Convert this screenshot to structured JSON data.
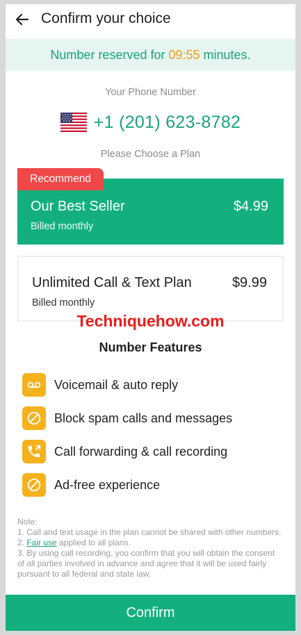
{
  "header": {
    "title": "Confirm your choice"
  },
  "timer": {
    "prefix": "Number reserved for ",
    "time": "09:55",
    "suffix": " minutes."
  },
  "phone": {
    "label": "Your Phone Number",
    "number": "+1 (201) 623-8782",
    "flag_icon": "us-flag-icon"
  },
  "plans": {
    "label": "Please Choose a Plan",
    "badge": "Recommend",
    "items": [
      {
        "name": "Our Best Seller",
        "price": "$4.99",
        "billing": "Billed monthly",
        "selected": true
      },
      {
        "name": "Unlimited Call & Text Plan",
        "price": "$9.99",
        "billing": "Billed monthly",
        "selected": false
      }
    ]
  },
  "watermark": "Techniquehow.com",
  "features": {
    "title": "Number Features",
    "items": [
      {
        "icon": "voicemail-icon",
        "label": "Voicemail & auto reply"
      },
      {
        "icon": "block-icon",
        "label": "Block spam calls and messages"
      },
      {
        "icon": "call-forward-icon",
        "label": "Call forwarding & call recording"
      },
      {
        "icon": "no-ads-icon",
        "label": "Ad-free experience"
      }
    ]
  },
  "notes": {
    "heading": "Note:",
    "line1": "1. Call and text usage in the plan cannot be shared with other numbers.",
    "line2_link": "Fair use",
    "line2_prefix": "2. ",
    "line2_suffix": " applied to all plans.",
    "line3": "3. By using call recording, you confirm that you will obtain the consent of all parties involved in advance and agree that it will be used fairly pursuant to all federal and state law."
  },
  "confirm_label": "Confirm",
  "colors": {
    "accent": "#13b07d",
    "badge": "#f04848",
    "timer": "#f39a1e",
    "icon_bg": "#f5b21d"
  }
}
